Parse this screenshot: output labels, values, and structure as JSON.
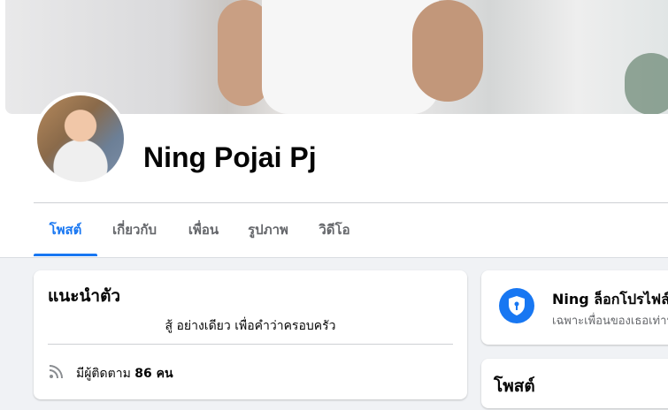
{
  "profile": {
    "name": "Ning Pojai Pj"
  },
  "tabs": [
    {
      "label": "โพสต์",
      "active": true
    },
    {
      "label": "เกี่ยวกับ",
      "active": false
    },
    {
      "label": "เพื่อน",
      "active": false
    },
    {
      "label": "รูปภาพ",
      "active": false
    },
    {
      "label": "วิดีโอ",
      "active": false
    }
  ],
  "intro": {
    "title": "แนะนำตัว",
    "bio": "สู้ อย่างเดียว เพื่อคำว่าครอบครัว",
    "followers_prefix": "มีผู้ติดตาม ",
    "followers_count": "86 คน"
  },
  "locked": {
    "title": "Ning ล็อกโปรไฟล์",
    "subtitle": "เฉพาะเพื่อนของเธอเท่านั้น"
  },
  "posts": {
    "title": "โพสต์"
  },
  "colors": {
    "accent": "#1877f2",
    "background": "#f0f2f5",
    "secondary_text": "#65676b"
  },
  "icons": {
    "followers": "rss-icon",
    "locked": "shield-lock-icon"
  }
}
